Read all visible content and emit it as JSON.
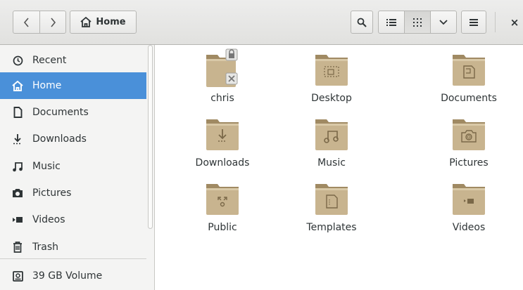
{
  "header": {
    "path_label": "Home",
    "icons": {
      "back": "chevron-left-icon",
      "forward": "chevron-right-icon",
      "home": "home-icon",
      "search": "search-icon",
      "list_view": "list-view-icon",
      "grid_view": "grid-view-icon",
      "view_options": "chevron-down-icon",
      "menu": "hamburger-menu-icon",
      "close": "close-icon"
    },
    "close_label": "×"
  },
  "sidebar": {
    "items": [
      {
        "label": "Recent",
        "icon": "clock-icon"
      },
      {
        "label": "Home",
        "icon": "home-icon",
        "selected": true
      },
      {
        "label": "Documents",
        "icon": "document-icon"
      },
      {
        "label": "Downloads",
        "icon": "download-icon"
      },
      {
        "label": "Music",
        "icon": "music-icon"
      },
      {
        "label": "Pictures",
        "icon": "camera-icon"
      },
      {
        "label": "Videos",
        "icon": "video-icon"
      },
      {
        "label": "Trash",
        "icon": "trash-icon"
      },
      {
        "label": "39 GB Volume",
        "icon": "drive-icon"
      }
    ]
  },
  "files": [
    {
      "label": "chris",
      "icon": "locked-folder-icon"
    },
    {
      "label": "Desktop",
      "icon": "desktop-folder-icon"
    },
    {
      "label": "Documents",
      "icon": "documents-folder-icon"
    },
    {
      "label": "Downloads",
      "icon": "downloads-folder-icon"
    },
    {
      "label": "Music",
      "icon": "music-folder-icon"
    },
    {
      "label": "Pictures",
      "icon": "pictures-folder-icon"
    },
    {
      "label": "Public",
      "icon": "public-folder-icon"
    },
    {
      "label": "Templates",
      "icon": "templates-folder-icon"
    },
    {
      "label": "Videos",
      "icon": "videos-folder-icon"
    }
  ],
  "colors": {
    "selection": "#4a90d9",
    "folder_body": "#c8b48f",
    "folder_tab": "#a08a63"
  }
}
